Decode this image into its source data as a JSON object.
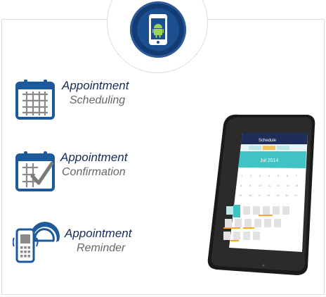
{
  "features": [
    {
      "title": "Appointment",
      "subtitle": "Scheduling",
      "icon": "calendar-grid-icon"
    },
    {
      "title": "Appointment",
      "subtitle": "Confirmation",
      "icon": "calendar-check-icon"
    },
    {
      "title": "Appointment",
      "subtitle": "Reminder",
      "icon": "phone-alarm-icon"
    }
  ],
  "badge": {
    "icon": "android-phone-icon"
  },
  "phone": {
    "app_title": "Schedule",
    "month_label": "Jul 2014",
    "colors": {
      "header": "#1e2d5a",
      "accent": "#3fc3c4",
      "highlight": "#f5a623"
    }
  }
}
